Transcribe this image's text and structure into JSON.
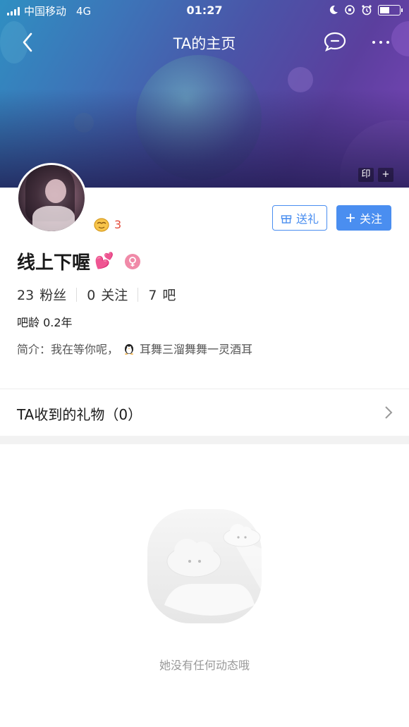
{
  "status_bar": {
    "carrier": "中国移动",
    "network": "4G",
    "time": "01:27"
  },
  "nav": {
    "title": "TA的主页"
  },
  "header": {
    "stamp_label": "印",
    "add_label": "+"
  },
  "profile": {
    "level": "3",
    "gift_button": "送礼",
    "follow_button": "关注",
    "username": "线上下喔",
    "username_emoji": "💕",
    "stats": {
      "fans_count": "23",
      "fans_label": "粉丝",
      "following_count": "0",
      "following_label": "关注",
      "bars_count": "7",
      "bars_label": "吧"
    },
    "bar_age": "吧龄 0.2年",
    "intro_prefix": "简介：我在等你呢，",
    "intro_suffix": "耳舞三溜舞舞一灵酒耳"
  },
  "gifts": {
    "label": "TA收到的礼物（0）"
  },
  "empty": {
    "message": "她没有任何动态哦"
  },
  "colors": {
    "accent": "#4a8ef0",
    "level": "#e34c3c",
    "gender": "#f08aa8"
  }
}
